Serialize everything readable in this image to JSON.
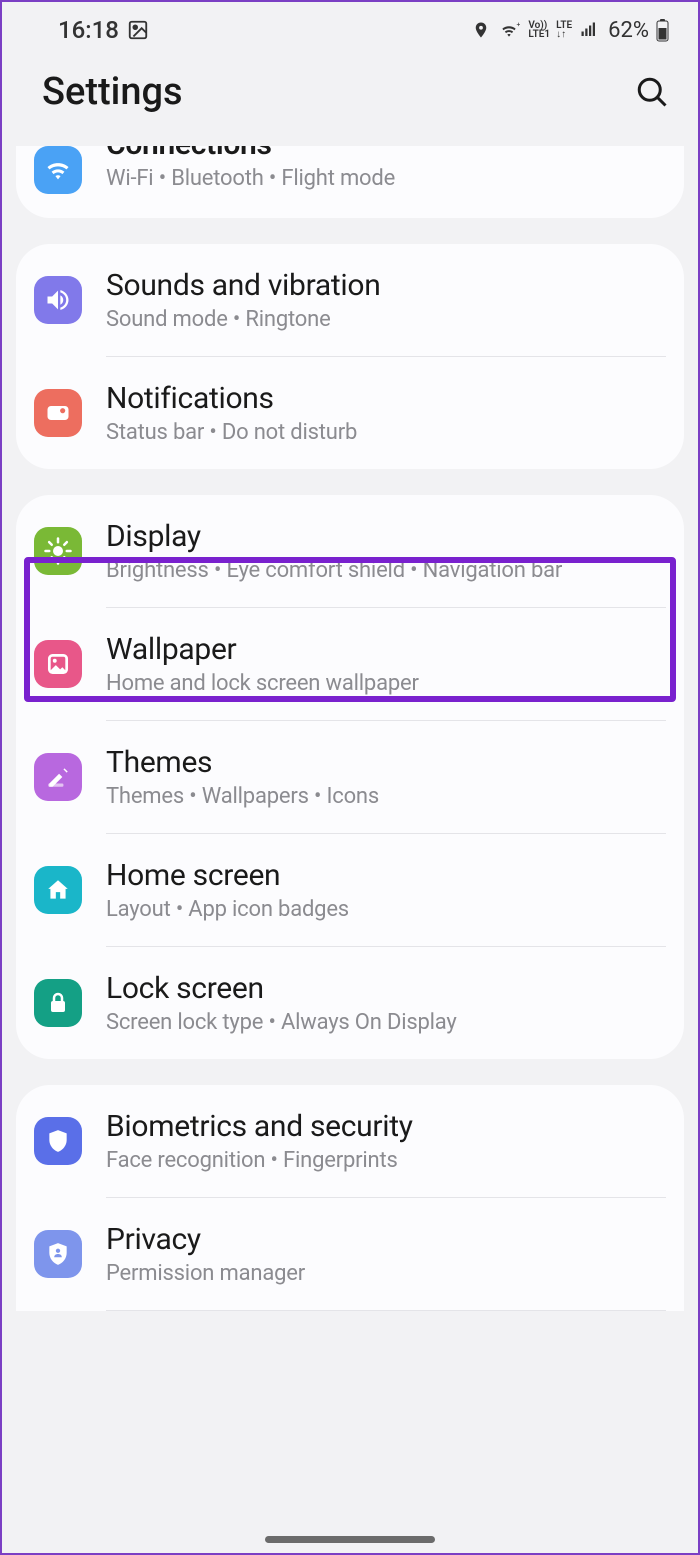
{
  "statusBar": {
    "time": "16:18",
    "battery": "62%",
    "lte": "LTE",
    "volte": "Vo))\nLTE1"
  },
  "header": {
    "title": "Settings"
  },
  "groups": [
    {
      "items": [
        {
          "title": "Connections",
          "sub": "Wi-Fi  •  Bluetooth  •  Flight mode",
          "iconColor": "#4aa2f5",
          "icon": "wifi",
          "clipped": true
        }
      ]
    },
    {
      "items": [
        {
          "title": "Sounds and vibration",
          "sub": "Sound mode  •  Ringtone",
          "iconColor": "#8179ea",
          "icon": "sound"
        },
        {
          "title": "Notifications",
          "sub": "Status bar  •  Do not disturb",
          "iconColor": "#ed6e5f",
          "icon": "notification"
        }
      ]
    },
    {
      "items": [
        {
          "title": "Display",
          "sub": "Brightness  •  Eye comfort shield  •  Navigation bar",
          "iconColor": "#7ab936",
          "icon": "brightness",
          "highlighted": true
        },
        {
          "title": "Wallpaper",
          "sub": "Home and lock screen wallpaper",
          "iconColor": "#e85789",
          "icon": "wallpaper"
        },
        {
          "title": "Themes",
          "sub": "Themes  •  Wallpapers  •  Icons",
          "iconColor": "#b868df",
          "icon": "themes"
        },
        {
          "title": "Home screen",
          "sub": "Layout  •  App icon badges",
          "iconColor": "#1ab6c9",
          "icon": "home"
        },
        {
          "title": "Lock screen",
          "sub": "Screen lock type  •  Always On Display",
          "iconColor": "#14a085",
          "icon": "lock"
        }
      ]
    },
    {
      "items": [
        {
          "title": "Biometrics and security",
          "sub": "Face recognition  •  Fingerprints",
          "iconColor": "#5a6fe8",
          "icon": "shield"
        },
        {
          "title": "Privacy",
          "sub": "Permission manager",
          "iconColor": "#7e95ec",
          "icon": "privacy"
        }
      ]
    }
  ]
}
